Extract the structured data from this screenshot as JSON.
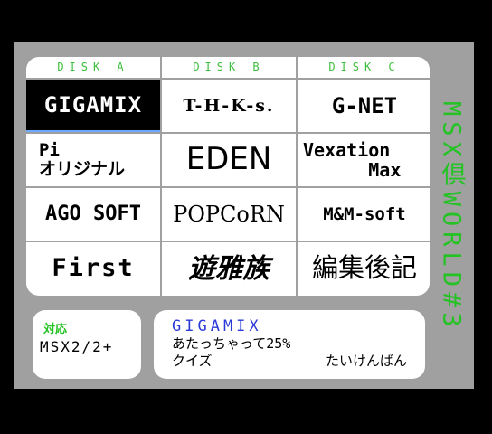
{
  "columns": [
    "DISK A",
    "DISK B",
    "DISK C"
  ],
  "grid": [
    [
      "GIGAMIX",
      "T-H-K-s.",
      "G-NET"
    ],
    [
      "Pi\nオリジナル",
      "EDEN",
      "Vexation\n      Max"
    ],
    [
      "AGO SOFT",
      "POPCoRN",
      "M&M-soft"
    ],
    [
      "First",
      "遊雅族",
      "編集後記"
    ]
  ],
  "selected_cell": "GIGAMIX",
  "compat": {
    "label": "対応",
    "value": "MSX2/2+"
  },
  "detail": {
    "title": "GIGAMIX",
    "line1": "あたっちゃって25%",
    "line2_left": "クイズ",
    "line2_right": "たいけんばん"
  },
  "vertical_title": "MSX倶WORLD#3",
  "colors": {
    "green": "#22c322",
    "blue": "#2a3ad8",
    "panel": "#a0a0a0",
    "highlight": "#6fa8ff"
  }
}
